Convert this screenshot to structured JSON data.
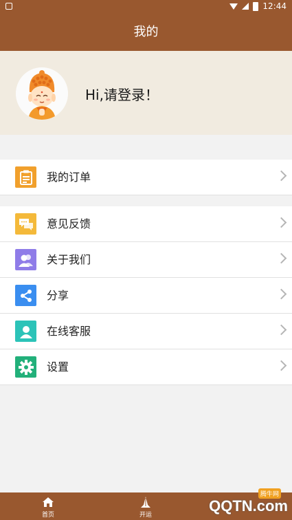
{
  "status": {
    "time": "12:44"
  },
  "header": {
    "title": "我的"
  },
  "profile": {
    "login_text": "Hi,请登录！"
  },
  "menu_group1": [
    {
      "label": "我的订单",
      "icon": "order-icon",
      "color": "#f1a02c"
    }
  ],
  "menu_group2": [
    {
      "label": "意见反馈",
      "icon": "feedback-icon",
      "color": "#f4b93a"
    },
    {
      "label": "关于我们",
      "icon": "about-us-icon",
      "color": "#8f7ce8"
    },
    {
      "label": "分享",
      "icon": "share-icon",
      "color": "#3a8ef0"
    },
    {
      "label": "在线客服",
      "icon": "customer-service-icon",
      "color": "#2cc3b8"
    },
    {
      "label": "设置",
      "icon": "settings-icon",
      "color": "#22b07a"
    }
  ],
  "tabbar": {
    "tabs": [
      {
        "label": "首页",
        "icon": "home-icon"
      },
      {
        "label": "开运",
        "icon": "prayer-icon"
      }
    ]
  },
  "watermark": {
    "text": "QQTN.com",
    "cn": "腾牛网"
  },
  "colors": {
    "brand": "#99582f",
    "profile_bg": "#f1ebe0"
  }
}
